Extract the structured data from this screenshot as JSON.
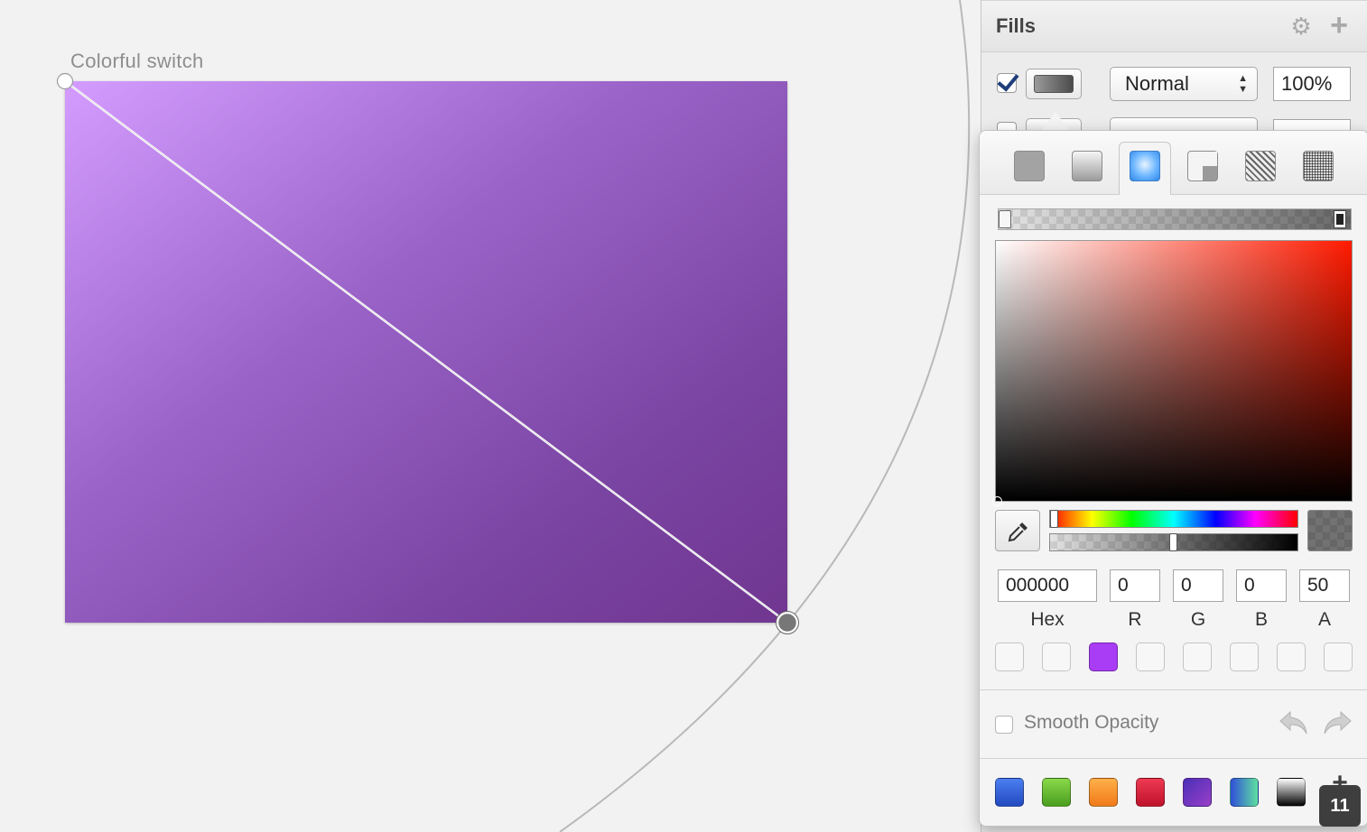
{
  "canvas": {
    "artboard_label": "Colorful switch"
  },
  "inspector": {
    "fills_title": "Fills",
    "fill_row": {
      "enabled": true,
      "blend_mode": "Normal",
      "opacity": "100%"
    }
  },
  "color_picker": {
    "fill_types": [
      "solid",
      "linear-gradient",
      "radial-gradient",
      "angular-gradient",
      "pattern",
      "noise"
    ],
    "selected_fill_type": "radial-gradient",
    "hex": {
      "value": "000000",
      "label": "Hex"
    },
    "r": {
      "value": "0",
      "label": "R"
    },
    "g": {
      "value": "0",
      "label": "G"
    },
    "b": {
      "value": "0",
      "label": "B"
    },
    "a": {
      "value": "50",
      "label": "A"
    },
    "document_swatch_colors": [
      "",
      "",
      "#a93cf5",
      "",
      "",
      "",
      "",
      ""
    ],
    "smooth_opacity_label": "Smooth Opacity",
    "global_swatch_colors": [
      "#2f62d8",
      "#5fb830",
      "#f5902a",
      "#d81e3a",
      "#6a2fb0",
      "#3aa0e0",
      "#222222"
    ],
    "presets_badge": "11"
  }
}
